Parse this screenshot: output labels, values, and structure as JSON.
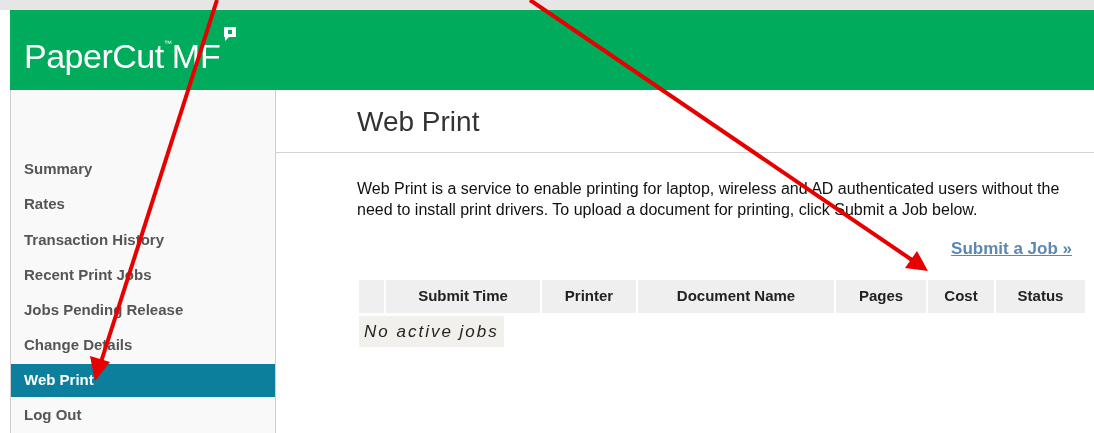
{
  "header": {
    "logo": {
      "name": "PaperCut",
      "mark": "™",
      "suffix": "MF"
    }
  },
  "sidebar": {
    "items": [
      {
        "label": "Summary",
        "selected": false
      },
      {
        "label": "Rates",
        "selected": false
      },
      {
        "label": "Transaction History",
        "selected": false
      },
      {
        "label": "Recent Print Jobs",
        "selected": false
      },
      {
        "label": "Jobs Pending Release",
        "selected": false
      },
      {
        "label": "Change Details",
        "selected": false
      },
      {
        "label": "Web Print",
        "selected": true
      },
      {
        "label": "Log Out",
        "selected": false
      }
    ]
  },
  "main": {
    "title": "Web Print",
    "description": "Web Print is a service to enable printing for laptop, wireless and AD authenticated users without the need to install print drivers. To upload a document for printing, click Submit a Job below.",
    "link": "Submit a Job »",
    "table": {
      "columns": [
        "",
        "Submit Time",
        "Printer",
        "Document Name",
        "Pages",
        "Cost",
        "Status"
      ],
      "empty_message": "No active jobs"
    }
  }
}
